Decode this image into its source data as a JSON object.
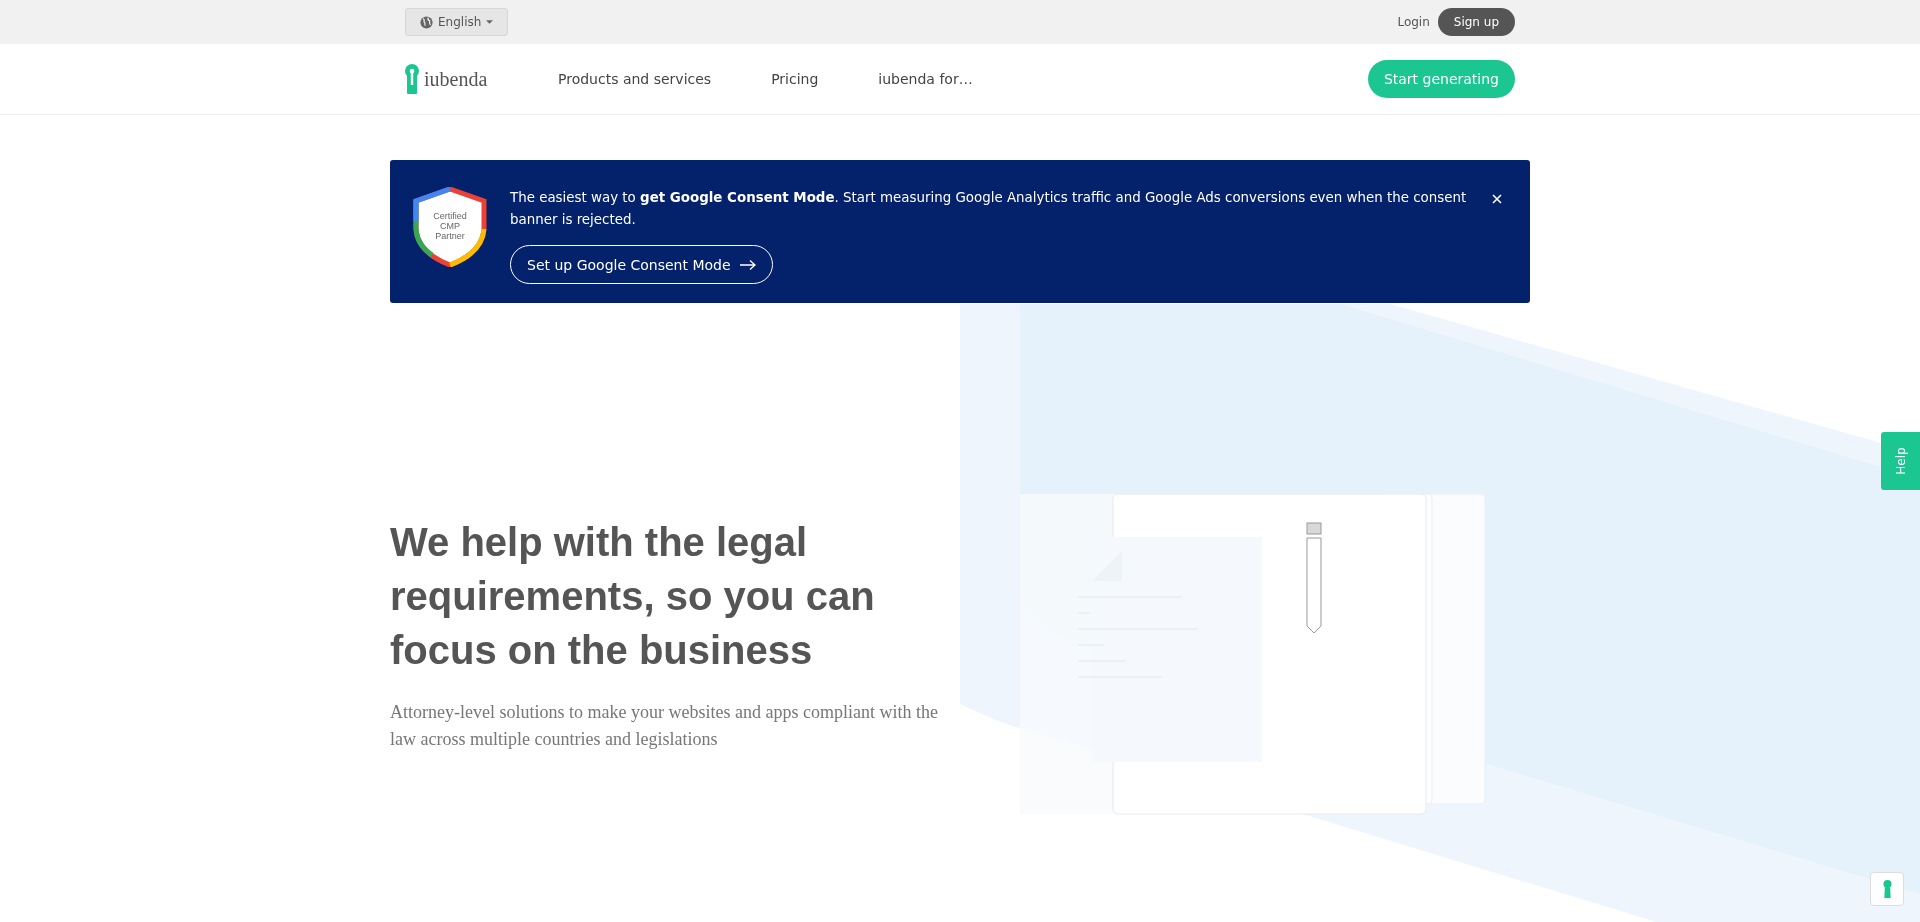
{
  "top_bar": {
    "language": "English",
    "login": "Login",
    "signup": "Sign up"
  },
  "nav": {
    "logo": "iubenda",
    "items": [
      "Products and services",
      "Pricing",
      "iubenda for…"
    ],
    "cta": "Start generating"
  },
  "banner": {
    "badge_lines": [
      "Certified",
      "CMP",
      "Partner"
    ],
    "text": "The easiest way to **get Google Consent Mode**. Start measuring Google Analytics traffic and Google Ads conversions even when the consent banner is rejected.",
    "button": "Set up Google Consent Mode"
  },
  "hero": {
    "title": "We help with the legal requirements, so you can focus on the business",
    "subtitle": "Attorney-level solutions to make your websites and apps compliant with the law across multiple countries and legislations"
  },
  "help_tab": "Help"
}
